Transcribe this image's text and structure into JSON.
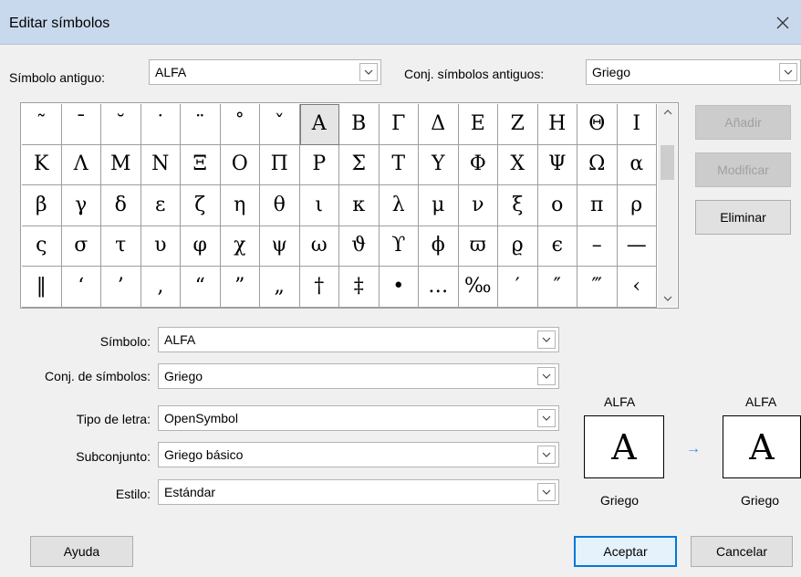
{
  "window": {
    "title": "Editar símbolos"
  },
  "top": {
    "old_symbol_label": "Símbolo antiguo:",
    "old_symbol_value": "ALFA",
    "old_set_label": "Conj. símbolos antiguos:",
    "old_set_value": "Griego"
  },
  "grid": {
    "rows": [
      [
        "˜",
        "¯",
        "˘",
        "˙",
        "¨",
        "˚",
        "ˇ",
        "Α",
        "Β",
        "Γ",
        "Δ",
        "Ε",
        "Ζ",
        "Η",
        "Θ",
        "Ι"
      ],
      [
        "Κ",
        "Λ",
        "Μ",
        "Ν",
        "Ξ",
        "Ο",
        "Π",
        "Ρ",
        "Σ",
        "Τ",
        "Υ",
        "Φ",
        "Χ",
        "Ψ",
        "Ω",
        "α"
      ],
      [
        "β",
        "γ",
        "δ",
        "ε",
        "ζ",
        "η",
        "θ",
        "ι",
        "κ",
        "λ",
        "μ",
        "ν",
        "ξ",
        "ο",
        "π",
        "ρ"
      ],
      [
        "ς",
        "σ",
        "τ",
        "υ",
        "φ",
        "χ",
        "ψ",
        "ω",
        "ϑ",
        "ϒ",
        "ϕ",
        "ϖ",
        "ϱ",
        "ϵ",
        "–",
        "—"
      ],
      [
        "‖",
        "‘",
        "’",
        "‚",
        "“",
        "”",
        "„",
        "†",
        "‡",
        "•",
        "…",
        "‰",
        "′",
        "″",
        "‴",
        "‹"
      ]
    ],
    "selected": "Α"
  },
  "side_buttons": {
    "add": "Añadir",
    "modify": "Modificar",
    "delete": "Eliminar"
  },
  "form": {
    "symbol_label": "Símbolo:",
    "symbol_value": "ALFA",
    "set_label": "Conj. de símbolos:",
    "set_value": "Griego",
    "font_label": "Tipo de letra:",
    "font_value": "OpenSymbol",
    "subset_label": "Subconjunto:",
    "subset_value": "Griego básico",
    "style_label": "Estilo:",
    "style_value": "Estándar"
  },
  "preview": {
    "old_name": "ALFA",
    "old_glyph": "Α",
    "old_set": "Griego",
    "arrow": "→",
    "new_name": "ALFA",
    "new_glyph": "Α",
    "new_set": "Griego"
  },
  "footer": {
    "help": "Ayuda",
    "ok": "Aceptar",
    "cancel": "Cancelar"
  },
  "colors": {
    "titlebar": "#c9d9ed",
    "accent": "#0078d7"
  }
}
